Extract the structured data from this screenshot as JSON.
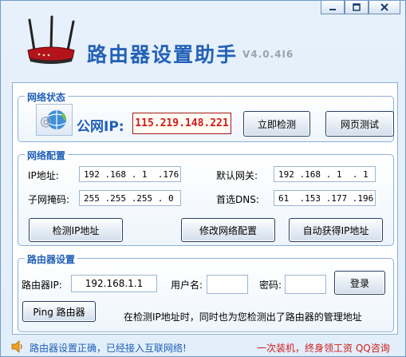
{
  "window": {
    "minimize_icon": "minimize-icon",
    "maximize_icon": "maximize-icon",
    "close_icon": "close-icon"
  },
  "header": {
    "title": "路由器设置助手",
    "version": "V4.0.4I6",
    "logo_icon": "router-icon"
  },
  "network_status": {
    "legend": "网络状态",
    "icon": "network-globe-icon",
    "public_ip_label": "公网IP:",
    "public_ip_value": "115.219.148.221",
    "detect_now_button": "立即检测",
    "web_test_button": "网页测试"
  },
  "network_config": {
    "legend": "网络配置",
    "ip_label": "IP地址:",
    "ip_value": "192 .168 . 1  .176",
    "subnet_label": "子网掩码:",
    "subnet_value": "255 .255 .255 . 0",
    "gateway_label": "默认网关:",
    "gateway_value": "192 .168 . 1  . 1",
    "dns_label": "首选DNS:",
    "dns_value": "61  .153 .177 .196",
    "detect_ip_button": "检测IP地址",
    "modify_config_button": "修改网络配置",
    "auto_ip_button": "自动获得IP地址"
  },
  "router_settings": {
    "legend": "路由器设置",
    "router_ip_label": "路由器IP:",
    "router_ip_value": "192.168.1.1",
    "username_label": "用户名:",
    "username_value": "",
    "password_label": "密码:",
    "password_value": "",
    "login_button": "登录",
    "ping_button": "Ping 路由器",
    "message": "在检测IP地址时，同时也为您检测出了路由器的管理地址"
  },
  "status_bar": {
    "speaker_icon": "speaker-icon",
    "status_text": "路由器设置正确，已经接入互联网络!",
    "promo_text": "一次装机，终身领工资  QQ咨询"
  },
  "colors": {
    "accent": "#1f5fb8",
    "ip_red": "#d01b1b",
    "panel_border": "#8eb0d6"
  }
}
